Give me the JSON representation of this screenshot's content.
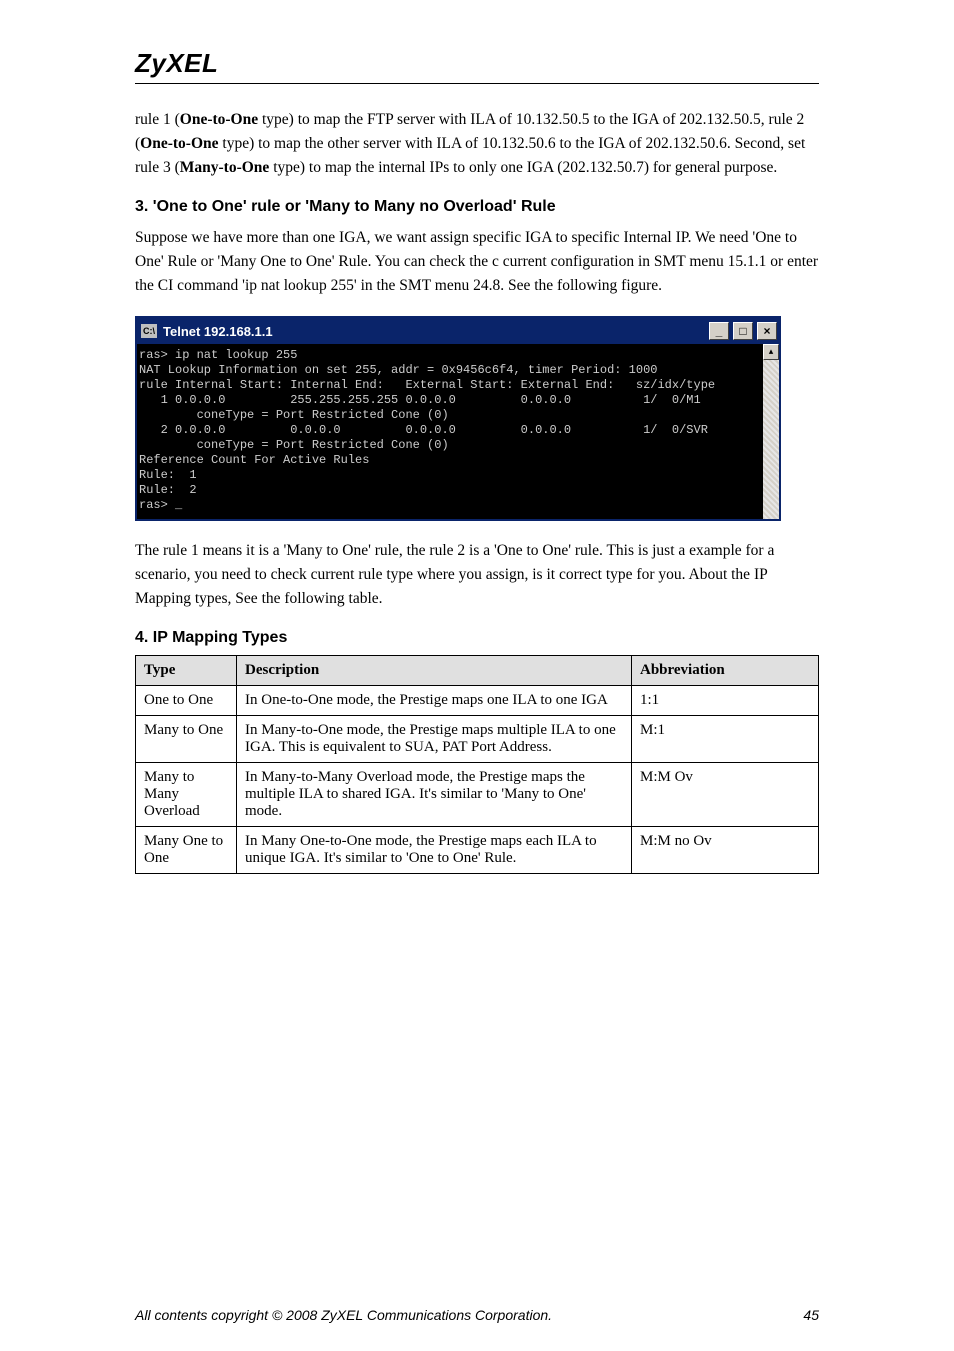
{
  "logo": "ZyXEL",
  "paragraphs": {
    "p1_a": "rule 1 (",
    "p1_b": "One-to-One",
    "p1_c": " type) to map the FTP server with ILA of 10.132.50.5 to the IGA of 202.132.50.5, rule 2 (",
    "p1_d": "One-to-One",
    "p1_e": " type) to map the other server with ILA of 10.132.50.6 to the IGA of 202.132.50.6. Second, set rule 3 (",
    "p1_f": "Many-to-One",
    "p1_g": " type) to map the internal IPs to only one IGA (202.132.50.7) for general purpose.",
    "p2": "Suppose we have more than one IGA, we want assign specific IGA to specific Internal IP. We need 'One to One' Rule or 'Many One to One' Rule. You can check the c current configuration in SMT menu 15.1.1 or enter the CI command 'ip nat lookup 255' in the SMT menu 24.8. See the following figure.",
    "p3_a": "The rule 1 means it is a 'Many to One' rule, the rule 2 is a 'One to One' rule. This is just ",
    "p3_b": "a example for a scenario, you need to check current rule type where you assign, is it correct type for you. About the IP Mapping types, See the following table."
  },
  "headings": {
    "h1": "3. 'One to One' rule or 'Many to Many no Overload' Rule",
    "h2": "4. ",
    "h2b": "IP Mapping Types"
  },
  "telnet": {
    "title": "Telnet 192.168.1.1",
    "icon_text": "C:\\",
    "lines": [
      "ras> ip nat lookup 255",
      "NAT Lookup Information on set 255, addr = 0x9456c6f4, timer Period: 1000",
      "rule Internal Start: Internal End:   External Start: External End:   sz/idx/type",
      "   1 0.0.0.0         255.255.255.255 0.0.0.0         0.0.0.0          1/  0/M1",
      "        coneType = Port Restricted Cone (0)",
      "   2 0.0.0.0         0.0.0.0         0.0.0.0         0.0.0.0          1/  0/SVR",
      "        coneType = Port Restricted Cone (0)",
      "",
      "Reference Count For Active Rules",
      "Rule:  1",
      "Rule:  2",
      "ras> _"
    ]
  },
  "table": {
    "headers": {
      "type": "Type",
      "desc": "Description",
      "abbr": "Abbreviation"
    },
    "rows": [
      {
        "type": "One to One",
        "desc": "In One-to-One mode, the Prestige maps one ILA to one IGA",
        "abbr": "1:1"
      },
      {
        "type": "Many to One",
        "desc": "In Many-to-One mode, the Prestige maps multiple ILA to one IGA. This is equivalent to SUA, PAT Port Address.",
        "abbr": "M:1"
      },
      {
        "type": "Many to Many Overload",
        "desc": "In Many-to-Many Overload mode, the Prestige maps the multiple ILA to shared IGA. It's similar to 'Many to One' mode.",
        "abbr": "M:M Ov"
      },
      {
        "type": "Many One to One",
        "desc": "In Many One-to-One mode, the Prestige maps each ILA to unique IGA. It's similar to 'One to One' Rule.",
        "abbr": "M:M no Ov"
      }
    ]
  },
  "footer": {
    "left": "All contents copyright © 2008 ZyXEL Communications Corporation.",
    "right": "45"
  }
}
